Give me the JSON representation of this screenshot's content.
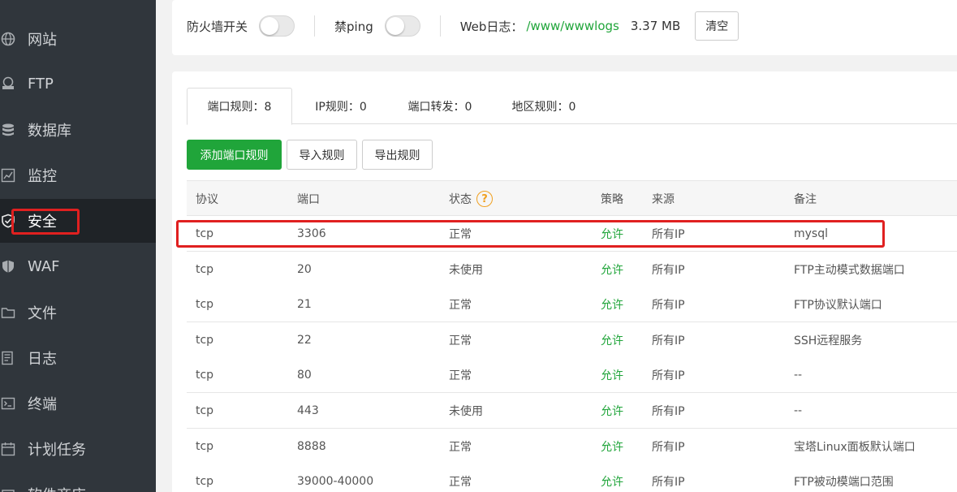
{
  "sidebar": {
    "items": [
      {
        "label": "网站",
        "icon": "globe-icon"
      },
      {
        "label": "FTP",
        "icon": "ftp-icon"
      },
      {
        "label": "数据库",
        "icon": "database-icon"
      },
      {
        "label": "监控",
        "icon": "monitor-chart-icon"
      },
      {
        "label": "安全",
        "icon": "shield-icon",
        "active": true
      },
      {
        "label": "WAF",
        "icon": "waf-shield-icon"
      },
      {
        "label": "文件",
        "icon": "folder-icon"
      },
      {
        "label": "日志",
        "icon": "log-icon"
      },
      {
        "label": "终端",
        "icon": "terminal-icon"
      },
      {
        "label": "计划任务",
        "icon": "calendar-icon"
      },
      {
        "label": "软件商店",
        "icon": "store-icon"
      }
    ]
  },
  "topbar": {
    "firewall_label": "防火墙开关",
    "ping_label": "禁ping",
    "weblog_label": "Web日志：",
    "weblog_path": "/www/wwwlogs",
    "weblog_size": "3.37 MB",
    "clear_label": "清空"
  },
  "tabs": [
    {
      "label": "端口规则：8"
    },
    {
      "label": "IP规则：0"
    },
    {
      "label": "端口转发：0"
    },
    {
      "label": "地区规则：0"
    }
  ],
  "actions": {
    "add_label": "添加端口规则",
    "import_label": "导入规则",
    "export_label": "导出规则"
  },
  "table": {
    "headers": {
      "protocol": "协议",
      "port": "端口",
      "status": "状态",
      "policy": "策略",
      "source": "来源",
      "remark": "备注"
    },
    "help_glyph": "?",
    "rows": [
      {
        "protocol": "tcp",
        "port": "3306",
        "status": "正常",
        "policy": "允许",
        "source": "所有IP",
        "remark": "mysql"
      },
      {
        "protocol": "tcp",
        "port": "20",
        "status": "未使用",
        "policy": "允许",
        "source": "所有IP",
        "remark": "FTP主动模式数据端口"
      },
      {
        "protocol": "tcp",
        "port": "21",
        "status": "正常",
        "policy": "允许",
        "source": "所有IP",
        "remark": "FTP协议默认端口"
      },
      {
        "protocol": "tcp",
        "port": "22",
        "status": "正常",
        "policy": "允许",
        "source": "所有IP",
        "remark": "SSH远程服务"
      },
      {
        "protocol": "tcp",
        "port": "80",
        "status": "正常",
        "policy": "允许",
        "source": "所有IP",
        "remark": "--"
      },
      {
        "protocol": "tcp",
        "port": "443",
        "status": "未使用",
        "policy": "允许",
        "source": "所有IP",
        "remark": "--"
      },
      {
        "protocol": "tcp",
        "port": "8888",
        "status": "正常",
        "policy": "允许",
        "source": "所有IP",
        "remark": "宝塔Linux面板默认端口"
      },
      {
        "protocol": "tcp",
        "port": "39000-40000",
        "status": "正常",
        "policy": "允许",
        "source": "所有IP",
        "remark": "FTP被动模端口范围"
      }
    ]
  },
  "colors": {
    "accent": "#20a53a",
    "highlight": "#e02020",
    "sidebar": "#30363c",
    "help": "#f0a020"
  }
}
